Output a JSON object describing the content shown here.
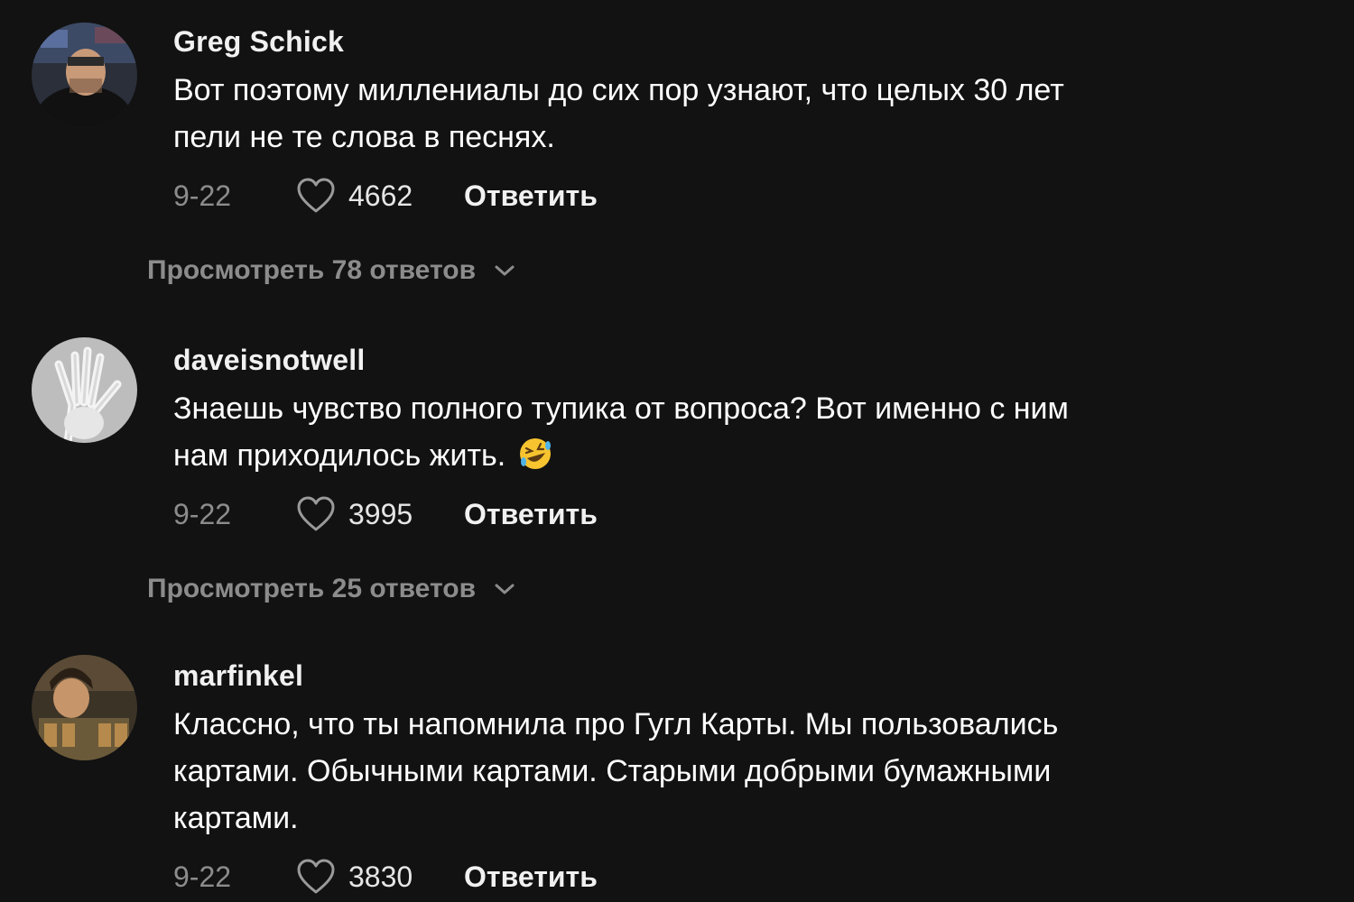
{
  "comments": [
    {
      "username": "Greg Schick",
      "text_lines": [
        "Вот поэтому миллениалы до сих пор узнают, что целых 30 лет",
        "пели не те слова в песнях."
      ],
      "date": "9-22",
      "likes": "4662",
      "reply_label": "Ответить",
      "view_replies": "Просмотреть 78 ответов"
    },
    {
      "username": "daveisnotwell",
      "text_lines": [
        "Знаешь чувство полного тупика от вопроса? Вот именно с ним",
        "нам приходилось жить."
      ],
      "emoji": "rolling-on-floor-laughing-emoji",
      "date": "9-22",
      "likes": "3995",
      "reply_label": "Ответить",
      "view_replies": "Просмотреть 25 ответов"
    },
    {
      "username": "marfinkel",
      "text_lines": [
        "Классно, что ты напомнила про Гугл Карты. Мы пользовались",
        "картами. Обычными картами. Старыми добрыми бумажными",
        "картами."
      ],
      "date": "9-22",
      "likes": "3830",
      "reply_label": "Ответить"
    }
  ],
  "colors": {
    "background": "#121212",
    "primary_text": "#ffffff",
    "secondary_text": "#8c8c8c"
  },
  "icons": {
    "like": "heart-outline-icon",
    "expand": "chevron-down-icon"
  }
}
